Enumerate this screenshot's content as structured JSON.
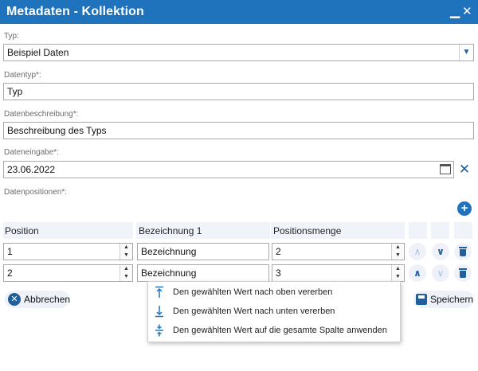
{
  "window": {
    "title": "Metadaten - Kollektion",
    "minimize_glyph": "▁",
    "close_glyph": "✕"
  },
  "form": {
    "typ": {
      "label": "Typ:",
      "value": "Beispiel Daten"
    },
    "datentyp": {
      "label": "Datentyp*:",
      "value": "Typ"
    },
    "datenbeschreibung": {
      "label": "Datenbeschreibung*:",
      "value": "Beschreibung des Typs"
    },
    "dateneingabe": {
      "label": "Dateneingabe*:",
      "value": "23.06.2022"
    },
    "datenpositionen": {
      "label": "Datenpositionen*:"
    }
  },
  "table": {
    "columns": [
      "Position",
      "Bezeichnung 1",
      "Positionsmenge"
    ],
    "rows": [
      {
        "position": "1",
        "bezeichnung": "Bezeichnung",
        "menge": "2"
      },
      {
        "position": "2",
        "bezeichnung": "Bezeichnung",
        "menge": "3"
      }
    ]
  },
  "footer": {
    "cancel_label": "Abbrechen",
    "save_label": "Speichern"
  },
  "context_menu": {
    "items": [
      {
        "label": "Den gewählten Wert nach oben vererben",
        "icon": "inherit-up-icon"
      },
      {
        "label": "Den gewählten Wert nach unten vererben",
        "icon": "inherit-down-icon"
      },
      {
        "label": "Den gewählten Wert auf die gesamte Spalte anwenden",
        "icon": "apply-column-icon"
      }
    ]
  },
  "colors": {
    "accent": "#1f73bd",
    "icon_blue": "#1f5f9c"
  }
}
